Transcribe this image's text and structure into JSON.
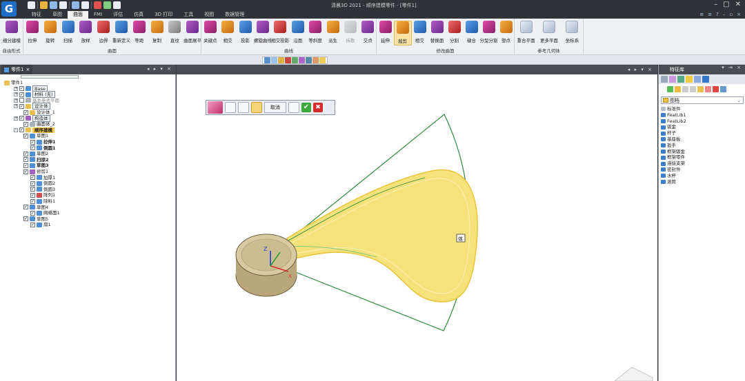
{
  "app": {
    "logo_letter": "G",
    "window_title": "清晨3D 2021 - 顺序建模零件 - [零件1]"
  },
  "menu": {
    "tabs": [
      "特征",
      "草图",
      "曲面",
      "FMI",
      "评估",
      "仿真",
      "3D 打印",
      "工具",
      "视图",
      "数据管理"
    ],
    "active_index": 2
  },
  "ribbon": {
    "groups": [
      {
        "label": "自由形式",
        "buttons": [
          "细分建模"
        ]
      },
      {
        "label": "曲面",
        "buttons": [
          "拉伸",
          "旋转",
          "扫描",
          "放样",
          "边界",
          "重新定义",
          "等距",
          "复制",
          "直纹",
          "曲面展平"
        ]
      },
      {
        "label": "曲线",
        "buttons": [
          "关键点",
          "相交",
          "投影",
          "螺旋曲线",
          "相交投影",
          "沿面",
          "等斜度",
          "派生",
          "拆散",
          "交点"
        ]
      },
      {
        "label": "修改曲面",
        "buttons": [
          "延伸",
          "裁剪",
          "相交",
          "替换面",
          "分割",
          "缝合",
          "分型分割",
          "塑点"
        ]
      },
      {
        "label": "参考几何体",
        "buttons": [
          "重合平面",
          "更多平面",
          "坐标系"
        ]
      }
    ],
    "active_button": "裁剪",
    "disabled_button": "拆散"
  },
  "left_panel": {
    "tab_label": "零件1",
    "tree": [
      {
        "text": "零件1",
        "level": 0,
        "icon": "part",
        "style": ""
      },
      {
        "text": "Base",
        "level": 1,
        "icon": "base",
        "style": "boxed"
      },
      {
        "text": "材料 (无)",
        "level": 1,
        "icon": "material",
        "style": "boxed"
      },
      {
        "text": "基本参考平面",
        "level": 1,
        "icon": "plane",
        "style": "gray"
      },
      {
        "text": "设计体",
        "level": 1,
        "icon": "body",
        "style": "boxed"
      },
      {
        "text": "设计体_1",
        "level": 2,
        "icon": "body",
        "style": ""
      },
      {
        "text": "构造体",
        "level": 1,
        "icon": "construct",
        "style": "boxed"
      },
      {
        "text": "曲面体_2",
        "level": 2,
        "icon": "surface",
        "style": ""
      },
      {
        "text": "顺序建模",
        "level": 1,
        "icon": "seq",
        "style": "highlight"
      },
      {
        "text": "草图1",
        "level": 2,
        "icon": "sketch",
        "style": ""
      },
      {
        "text": "拉伸1",
        "level": 3,
        "icon": "extrude",
        "style": "bold"
      },
      {
        "text": "倒圆1",
        "level": 3,
        "icon": "round",
        "style": "bold"
      },
      {
        "text": "草图2",
        "level": 2,
        "icon": "sketch",
        "style": ""
      },
      {
        "text": "扫掠2",
        "level": 2,
        "icon": "sweep",
        "style": "bold"
      },
      {
        "text": "草图3",
        "level": 2,
        "icon": "sketch",
        "style": "bold"
      },
      {
        "text": "修剪1",
        "level": 2,
        "icon": "trim",
        "style": ""
      },
      {
        "text": "加厚1",
        "level": 3,
        "icon": "thicken",
        "style": ""
      },
      {
        "text": "倒圆2",
        "level": 3,
        "icon": "round",
        "style": ""
      },
      {
        "text": "倒圆3",
        "level": 3,
        "icon": "round",
        "style": ""
      },
      {
        "text": "阵列1",
        "level": 3,
        "icon": "pattern",
        "style": ""
      },
      {
        "text": "除料1",
        "level": 3,
        "icon": "cut",
        "style": ""
      },
      {
        "text": "草图4",
        "level": 2,
        "icon": "sketch",
        "style": ""
      },
      {
        "text": "网格面1",
        "level": 3,
        "icon": "mesh",
        "style": ""
      },
      {
        "text": "草图5",
        "level": 2,
        "icon": "sketch",
        "style": ""
      },
      {
        "text": "扇1",
        "level": 3,
        "icon": "fan",
        "style": ""
      }
    ]
  },
  "command_bar": {
    "cancel_label": "取消",
    "ok_glyph": "✔",
    "close_glyph": "✖"
  },
  "viewport": {
    "axis_z_label": "Z",
    "axis_x_label": "X",
    "tag_label": "体"
  },
  "right_panel": {
    "title": "特征库",
    "dropdown_value": "图档",
    "items": [
      "标准件",
      "FeatLib1",
      "FeatLib2",
      "钣金",
      "杆子",
      "基座板",
      "扳手",
      "框架钣金",
      "框架零件",
      "连接支架",
      "密封件",
      "水杯",
      "滚筒"
    ]
  },
  "colors": {
    "accent": "#f8c84e",
    "dark_chrome": "#2f3236",
    "ribbon_bg": "#eef0f3",
    "surface_yellow": "#f3dc5a",
    "wire_green": "#2c8a3a"
  }
}
